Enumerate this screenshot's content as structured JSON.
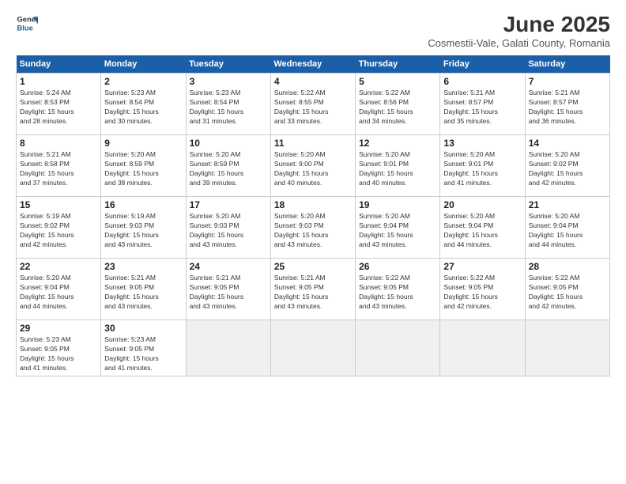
{
  "logo": {
    "line1": "General",
    "line2": "Blue"
  },
  "title": "June 2025",
  "subtitle": "Cosmestii-Vale, Galati County, Romania",
  "headers": [
    "Sunday",
    "Monday",
    "Tuesday",
    "Wednesday",
    "Thursday",
    "Friday",
    "Saturday"
  ],
  "weeks": [
    [
      {
        "day": "1",
        "info": "Sunrise: 5:24 AM\nSunset: 8:53 PM\nDaylight: 15 hours\nand 28 minutes."
      },
      {
        "day": "2",
        "info": "Sunrise: 5:23 AM\nSunset: 8:54 PM\nDaylight: 15 hours\nand 30 minutes."
      },
      {
        "day": "3",
        "info": "Sunrise: 5:23 AM\nSunset: 8:54 PM\nDaylight: 15 hours\nand 31 minutes."
      },
      {
        "day": "4",
        "info": "Sunrise: 5:22 AM\nSunset: 8:55 PM\nDaylight: 15 hours\nand 33 minutes."
      },
      {
        "day": "5",
        "info": "Sunrise: 5:22 AM\nSunset: 8:56 PM\nDaylight: 15 hours\nand 34 minutes."
      },
      {
        "day": "6",
        "info": "Sunrise: 5:21 AM\nSunset: 8:57 PM\nDaylight: 15 hours\nand 35 minutes."
      },
      {
        "day": "7",
        "info": "Sunrise: 5:21 AM\nSunset: 8:57 PM\nDaylight: 15 hours\nand 36 minutes."
      }
    ],
    [
      {
        "day": "8",
        "info": "Sunrise: 5:21 AM\nSunset: 8:58 PM\nDaylight: 15 hours\nand 37 minutes."
      },
      {
        "day": "9",
        "info": "Sunrise: 5:20 AM\nSunset: 8:59 PM\nDaylight: 15 hours\nand 38 minutes."
      },
      {
        "day": "10",
        "info": "Sunrise: 5:20 AM\nSunset: 8:59 PM\nDaylight: 15 hours\nand 39 minutes."
      },
      {
        "day": "11",
        "info": "Sunrise: 5:20 AM\nSunset: 9:00 PM\nDaylight: 15 hours\nand 40 minutes."
      },
      {
        "day": "12",
        "info": "Sunrise: 5:20 AM\nSunset: 9:01 PM\nDaylight: 15 hours\nand 40 minutes."
      },
      {
        "day": "13",
        "info": "Sunrise: 5:20 AM\nSunset: 9:01 PM\nDaylight: 15 hours\nand 41 minutes."
      },
      {
        "day": "14",
        "info": "Sunrise: 5:20 AM\nSunset: 9:02 PM\nDaylight: 15 hours\nand 42 minutes."
      }
    ],
    [
      {
        "day": "15",
        "info": "Sunrise: 5:19 AM\nSunset: 9:02 PM\nDaylight: 15 hours\nand 42 minutes."
      },
      {
        "day": "16",
        "info": "Sunrise: 5:19 AM\nSunset: 9:03 PM\nDaylight: 15 hours\nand 43 minutes."
      },
      {
        "day": "17",
        "info": "Sunrise: 5:20 AM\nSunset: 9:03 PM\nDaylight: 15 hours\nand 43 minutes."
      },
      {
        "day": "18",
        "info": "Sunrise: 5:20 AM\nSunset: 9:03 PM\nDaylight: 15 hours\nand 43 minutes."
      },
      {
        "day": "19",
        "info": "Sunrise: 5:20 AM\nSunset: 9:04 PM\nDaylight: 15 hours\nand 43 minutes."
      },
      {
        "day": "20",
        "info": "Sunrise: 5:20 AM\nSunset: 9:04 PM\nDaylight: 15 hours\nand 44 minutes."
      },
      {
        "day": "21",
        "info": "Sunrise: 5:20 AM\nSunset: 9:04 PM\nDaylight: 15 hours\nand 44 minutes."
      }
    ],
    [
      {
        "day": "22",
        "info": "Sunrise: 5:20 AM\nSunset: 9:04 PM\nDaylight: 15 hours\nand 44 minutes."
      },
      {
        "day": "23",
        "info": "Sunrise: 5:21 AM\nSunset: 9:05 PM\nDaylight: 15 hours\nand 43 minutes."
      },
      {
        "day": "24",
        "info": "Sunrise: 5:21 AM\nSunset: 9:05 PM\nDaylight: 15 hours\nand 43 minutes."
      },
      {
        "day": "25",
        "info": "Sunrise: 5:21 AM\nSunset: 9:05 PM\nDaylight: 15 hours\nand 43 minutes."
      },
      {
        "day": "26",
        "info": "Sunrise: 5:22 AM\nSunset: 9:05 PM\nDaylight: 15 hours\nand 43 minutes."
      },
      {
        "day": "27",
        "info": "Sunrise: 5:22 AM\nSunset: 9:05 PM\nDaylight: 15 hours\nand 42 minutes."
      },
      {
        "day": "28",
        "info": "Sunrise: 5:22 AM\nSunset: 9:05 PM\nDaylight: 15 hours\nand 42 minutes."
      }
    ],
    [
      {
        "day": "29",
        "info": "Sunrise: 5:23 AM\nSunset: 9:05 PM\nDaylight: 15 hours\nand 41 minutes."
      },
      {
        "day": "30",
        "info": "Sunrise: 5:23 AM\nSunset: 9:05 PM\nDaylight: 15 hours\nand 41 minutes."
      },
      {
        "day": "",
        "info": ""
      },
      {
        "day": "",
        "info": ""
      },
      {
        "day": "",
        "info": ""
      },
      {
        "day": "",
        "info": ""
      },
      {
        "day": "",
        "info": ""
      }
    ]
  ]
}
